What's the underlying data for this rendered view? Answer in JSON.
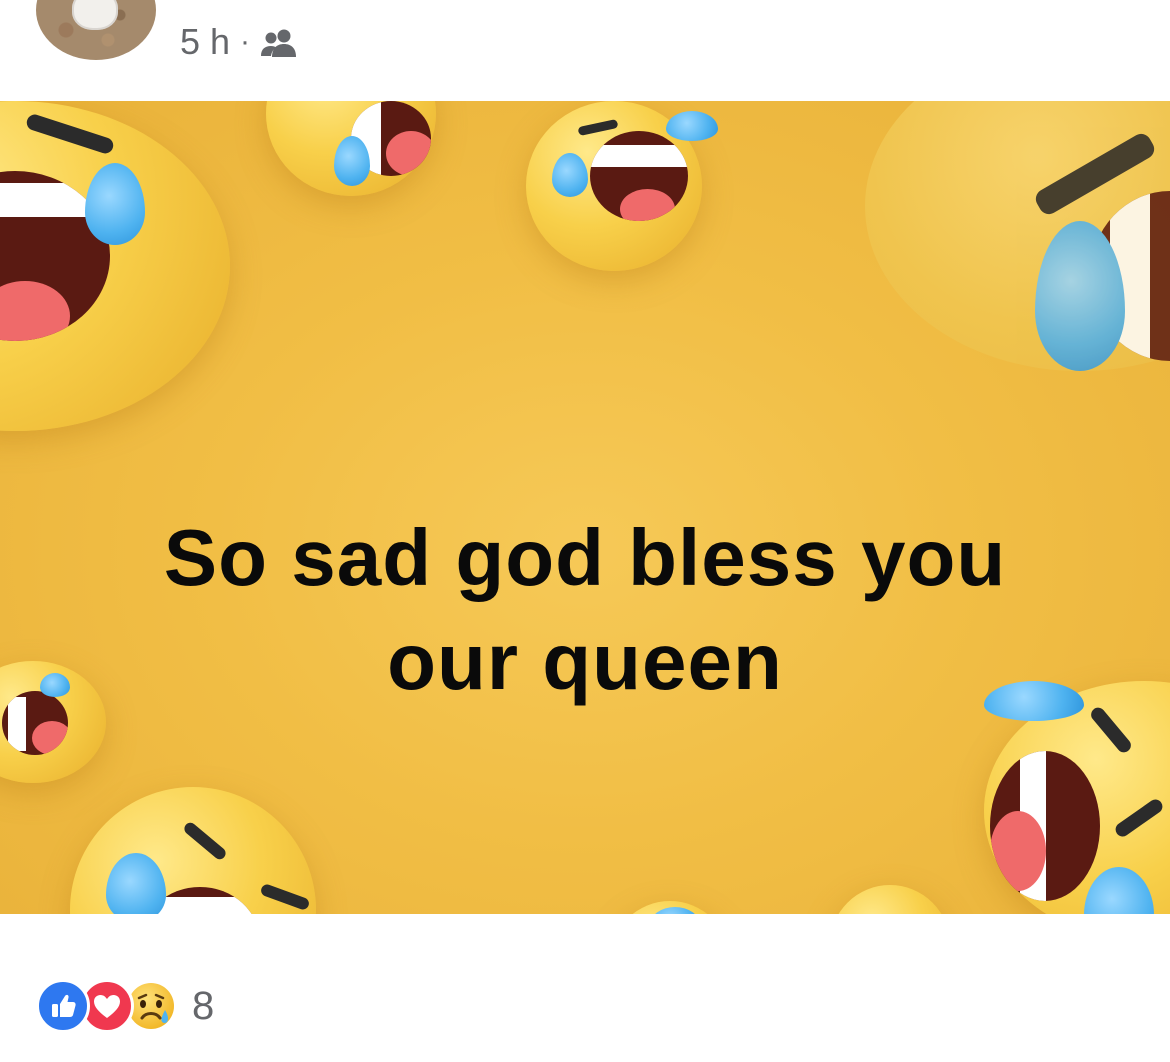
{
  "post": {
    "time": "5 h",
    "separator": "·",
    "audience_icon": "friends-icon"
  },
  "image": {
    "headline_line1": "So sad god bless you",
    "headline_line2": "our queen",
    "background_color": "#f1be45"
  },
  "reactions": {
    "icons": [
      "like-icon",
      "love-icon",
      "sad-icon"
    ],
    "count": "8",
    "like_color": "#2e78f0",
    "love_color": "#f0384f"
  }
}
